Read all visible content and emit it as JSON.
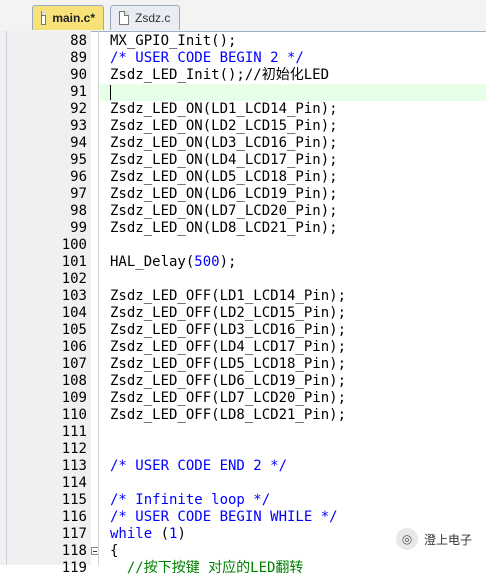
{
  "tabs": [
    {
      "label": "main.c*",
      "active": true
    },
    {
      "label": "Zsdz.c",
      "active": false
    }
  ],
  "lines": [
    {
      "num": "88",
      "text": "MX_GPIO_Init();",
      "style": "normal"
    },
    {
      "num": "89",
      "text": "/* USER CODE BEGIN 2 */",
      "style": "comment"
    },
    {
      "num": "90",
      "text": "Zsdz_LED_Init();//初始化LED",
      "style": "mixed90"
    },
    {
      "num": "91",
      "text": "",
      "style": "normal"
    },
    {
      "num": "92",
      "text": "Zsdz_LED_ON(LD1_LCD14_Pin);",
      "style": "normal"
    },
    {
      "num": "93",
      "text": "Zsdz_LED_ON(LD2_LCD15_Pin);",
      "style": "normal"
    },
    {
      "num": "94",
      "text": "Zsdz_LED_ON(LD3_LCD16_Pin);",
      "style": "normal"
    },
    {
      "num": "95",
      "text": "Zsdz_LED_ON(LD4_LCD17_Pin);",
      "style": "normal"
    },
    {
      "num": "96",
      "text": "Zsdz_LED_ON(LD5_LCD18_Pin);",
      "style": "normal"
    },
    {
      "num": "97",
      "text": "Zsdz_LED_ON(LD6_LCD19_Pin);",
      "style": "normal"
    },
    {
      "num": "98",
      "text": "Zsdz_LED_ON(LD7_LCD20_Pin);",
      "style": "normal"
    },
    {
      "num": "99",
      "text": "Zsdz_LED_ON(LD8_LCD21_Pin);",
      "style": "normal"
    },
    {
      "num": "100",
      "text": "",
      "style": "normal"
    },
    {
      "num": "101",
      "text": "HAL_Delay(500);",
      "style": "delay"
    },
    {
      "num": "102",
      "text": "",
      "style": "normal"
    },
    {
      "num": "103",
      "text": "Zsdz_LED_OFF(LD1_LCD14_Pin);",
      "style": "normal"
    },
    {
      "num": "104",
      "text": "Zsdz_LED_OFF(LD2_LCD15_Pin);",
      "style": "normal"
    },
    {
      "num": "105",
      "text": "Zsdz_LED_OFF(LD3_LCD16_Pin);",
      "style": "normal"
    },
    {
      "num": "106",
      "text": "Zsdz_LED_OFF(LD4_LCD17_Pin);",
      "style": "normal"
    },
    {
      "num": "107",
      "text": "Zsdz_LED_OFF(LD5_LCD18_Pin);",
      "style": "normal"
    },
    {
      "num": "108",
      "text": "Zsdz_LED_OFF(LD6_LCD19_Pin);",
      "style": "normal"
    },
    {
      "num": "109",
      "text": "Zsdz_LED_OFF(LD7_LCD20_Pin);",
      "style": "normal"
    },
    {
      "num": "110",
      "text": "Zsdz_LED_OFF(LD8_LCD21_Pin);",
      "style": "normal"
    },
    {
      "num": "111",
      "text": "",
      "style": "normal"
    },
    {
      "num": "112",
      "text": "",
      "style": "normal"
    },
    {
      "num": "113",
      "text": "/* USER CODE END 2 */",
      "style": "comment"
    },
    {
      "num": "114",
      "text": "",
      "style": "normal"
    },
    {
      "num": "115",
      "text": "/* Infinite loop */",
      "style": "comment"
    },
    {
      "num": "116",
      "text": "/* USER CODE BEGIN WHILE */",
      "style": "comment"
    },
    {
      "num": "117",
      "text": "while (1)",
      "style": "while"
    },
    {
      "num": "118",
      "text": "{",
      "style": "normal"
    },
    {
      "num": "119",
      "text": "  //按下按键 对应的LED翻转",
      "style": "cmt-green"
    }
  ],
  "watermark": {
    "icon": "wechat-icon",
    "text": "澄上电子"
  },
  "colors": {
    "comment": "#0000ff",
    "tab_active": "#f7e27a",
    "gutter": "#f0f0f0",
    "current_line": "#e6ffe6"
  }
}
